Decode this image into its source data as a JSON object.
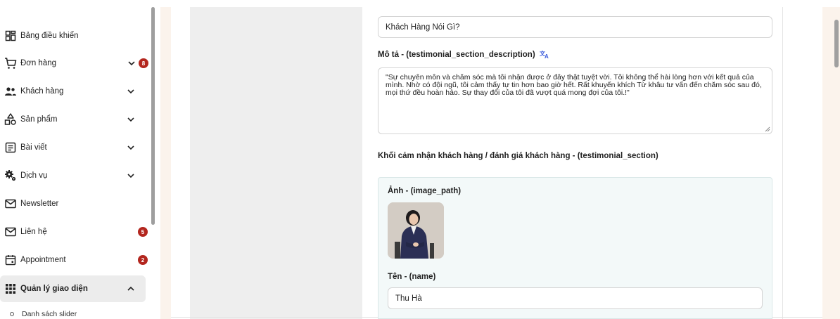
{
  "sidebar": {
    "items": [
      {
        "label": "Bảng điều khiển",
        "icon": "dashboard-icon"
      },
      {
        "label": "Đơn hàng",
        "icon": "cart-icon",
        "badge": "8"
      },
      {
        "label": "Khách hàng",
        "icon": "users-icon"
      },
      {
        "label": "Sản phẩm",
        "icon": "products-icon"
      },
      {
        "label": "Bài viết",
        "icon": "article-icon"
      },
      {
        "label": "Dịch vụ",
        "icon": "gears-icon"
      },
      {
        "label": "Newsletter",
        "icon": "mail-icon"
      },
      {
        "label": "Liên hệ",
        "icon": "mail-icon",
        "badge": "5"
      },
      {
        "label": "Appointment",
        "icon": "calendar-icon",
        "badge": "2"
      },
      {
        "label": "Quản lý giao diện",
        "icon": "grid-icon"
      }
    ],
    "sub_items": [
      {
        "label": "Danh sách slider"
      }
    ]
  },
  "form": {
    "title_value": "Khách Hàng Nói Gì?",
    "description_label": "Mô tả - (testimonial_section_description)",
    "description_value": "\"Sự chuyên môn và chăm sóc mà tôi nhận được ở đây thật tuyệt vời. Tôi không thể hài lòng hơn với kết quả của mình. Nhờ có đội ngũ, tôi cảm thấy tự tin hơn bao giờ hết. Rất khuyến khích Từ khâu tư vấn đến chăm sóc sau đó, mọi thứ đều hoàn hảo. Sự thay đổi của tôi đã vượt quá mong đợi của tôi.!\"",
    "section_label": "Khối cảm nhận khách hàng / đánh giá khách hàng - (testimonial_section)",
    "image_label": "Ảnh - (image_path)",
    "name_label": "Tên - (name)",
    "name_value": "Thu Hà"
  },
  "colors": {
    "badge": "#b3261e",
    "translate_icon": "#3b5bdb",
    "main_bg": "#fbf3ec"
  }
}
